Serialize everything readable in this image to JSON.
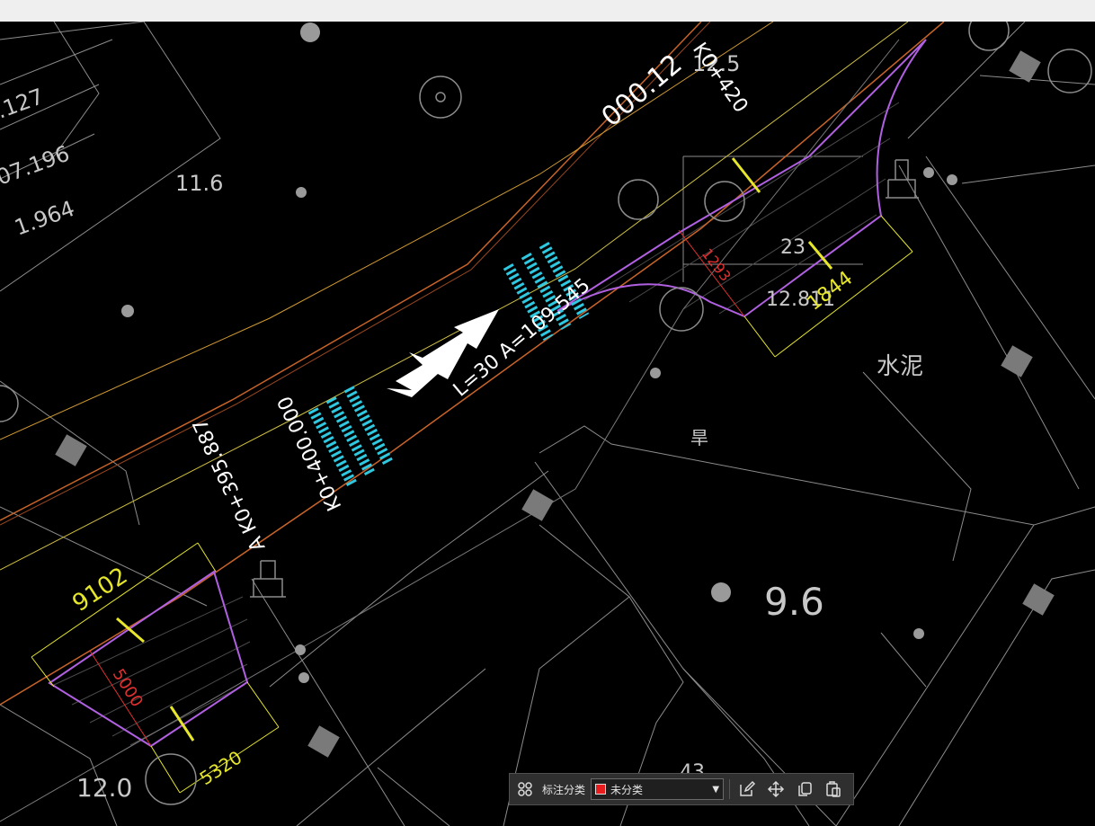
{
  "colors": {
    "background": "#000000",
    "road_edge": "#c86428",
    "boundary": "#b060e0",
    "dimension": "#e6e62c",
    "crosswalk": "#2ec8e0",
    "annotation_red": "#e03030",
    "linework": "#8c8c8c"
  },
  "drawing": {
    "labels": [
      {
        "text": ".127"
      },
      {
        "text": "07.196"
      },
      {
        "text": "1.964"
      },
      {
        "text": "11.6"
      },
      {
        "text": "12.5"
      },
      {
        "text": "000.12"
      },
      {
        "text": "K0+420"
      },
      {
        "text": "A K0+395.887"
      },
      {
        "text": "K0+400.000"
      },
      {
        "text": "L=30  A=109.545"
      },
      {
        "text": "12.811"
      },
      {
        "text": "水泥"
      },
      {
        "text": "旱"
      },
      {
        "text": "9.6"
      },
      {
        "text": "12.0"
      },
      {
        "text": "43"
      },
      {
        "text": "23"
      }
    ],
    "dimensions": [
      {
        "text": "9102",
        "color": "dimension"
      },
      {
        "text": "5320",
        "color": "dimension"
      },
      {
        "text": "1844",
        "color": "dimension"
      },
      {
        "text": "5000",
        "color": "annotation_red"
      },
      {
        "text": "1293",
        "color": "annotation_red"
      }
    ]
  },
  "toolbar": {
    "grid_icon": "grid-icon",
    "category_label": "标注分类",
    "category_value": "未分类",
    "category_color": "#e81c1c",
    "edit_icon": "edit-icon",
    "move_icon": "move-icon",
    "copy_icon": "copy-icon",
    "paste_icon": "paste-icon"
  }
}
